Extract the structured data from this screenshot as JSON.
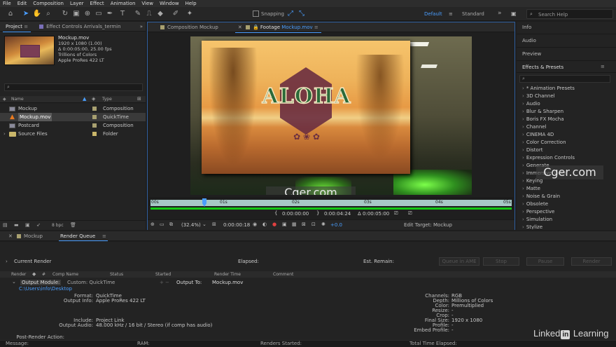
{
  "menu": [
    "File",
    "Edit",
    "Composition",
    "Layer",
    "Effect",
    "Animation",
    "View",
    "Window",
    "Help"
  ],
  "toolbar": {
    "snapping": "Snapping",
    "workspace_default": "Default",
    "workspace_standard": "Standard",
    "search_placeholder": "Search Help"
  },
  "project_panel": {
    "tab_project": "Project",
    "tab_effect_controls": "Effect Controls Arrivals_termin",
    "selected_name": "Mockup.mov",
    "info": [
      "1920 x 1080 (1.00)",
      "Δ 0:00:05:00, 25.00 fps",
      "Trillions of Colors",
      "Apple ProRes 422 LT"
    ],
    "col_name": "Name",
    "col_type": "Type",
    "items": [
      {
        "name": "Mockup",
        "type": "Composition",
        "color": "#a8a070"
      },
      {
        "name": "Mockup.mov",
        "type": "QuickTime",
        "color": "#a8a070"
      },
      {
        "name": "Postcard",
        "type": "Composition",
        "color": "#a8a070"
      },
      {
        "name": "Source Files",
        "type": "Folder",
        "color": "#c9b66a"
      }
    ],
    "bpc": "8 bpc"
  },
  "viewer": {
    "tab_comp": "Composition Mockup",
    "tab_footage": "Footage",
    "tab_footage_name": "Mockup.mov",
    "scene_text": "ALOHA",
    "watermark": "Cger.com",
    "time_ticks": [
      "00s",
      "01s",
      "02s",
      "03s",
      "04s",
      "05s"
    ],
    "in_time": "0:00:00:00",
    "out_time": "0:00:04:24",
    "duration": "Δ 0:00:05:00",
    "zoom": "(32.4%)",
    "current_time": "0:00:00:18",
    "exposure": "+0.0",
    "edit_target": "Edit Target: Mockup"
  },
  "right_panel": {
    "info": "Info",
    "audio": "Audio",
    "preview": "Preview",
    "effects_title": "Effects & Presets",
    "effects_list": [
      "* Animation Presets",
      "3D Channel",
      "Audio",
      "Blur & Sharpen",
      "Boris FX Mocha",
      "Channel",
      "CINEMA 4D",
      "Color Correction",
      "Distort",
      "Expression Controls",
      "Generate",
      "Immersive Video",
      "Keying",
      "Matte",
      "Noise & Grain",
      "Obsolete",
      "Perspective",
      "Simulation",
      "Stylize"
    ]
  },
  "bottom_tabs": {
    "mockup": "Mockup",
    "render_queue": "Render Queue"
  },
  "render_queue": {
    "current_render": "Current Render",
    "elapsed": "Elapsed:",
    "est_remain": "Est. Remain:",
    "queue_ame": "Queue in AME",
    "stop": "Stop",
    "pause": "Pause",
    "render": "Render",
    "headers": [
      "Render",
      "#",
      "Comp Name",
      "Status",
      "Started",
      "Render Time",
      "Comment"
    ],
    "output_module_label": "Output Module:",
    "output_module_value": "Custom: QuickTime",
    "output_to_label": "Output To:",
    "output_to_value": "Mockup.mov",
    "path": "C:\\Users\\info\\Desktop",
    "left_details": [
      {
        "label": "Format:",
        "value": "QuickTime"
      },
      {
        "label": "Output Info:",
        "value": "Apple ProRes 422 LT"
      },
      {
        "label": "Include:",
        "value": "Project Link"
      },
      {
        "label": "Output Audio:",
        "value": "48.000 kHz / 16 bit / Stereo (if comp has audio)"
      }
    ],
    "right_details": [
      {
        "label": "Channels:",
        "value": "RGB"
      },
      {
        "label": "Depth:",
        "value": "Millions of Colors"
      },
      {
        "label": "Color:",
        "value": "Premultiplied"
      },
      {
        "label": "Resize:",
        "value": "-"
      },
      {
        "label": "Crop:",
        "value": "-"
      },
      {
        "label": "Final Size:",
        "value": "1920 x 1080"
      },
      {
        "label": "Profile:",
        "value": "-"
      },
      {
        "label": "Embed Profile:",
        "value": "-"
      }
    ],
    "post_render": "Post-Render Action:"
  },
  "status_bar": {
    "message": "Message:",
    "ram": "RAM:",
    "renders_started": "Renders Started:",
    "total_time": "Total Time Elapsed:"
  },
  "branding": {
    "linkedin": "Linked",
    "in": "in",
    "learning": "Learning"
  },
  "colors": {
    "accent": "#4a9eff",
    "timeline_green": "#14c914"
  }
}
